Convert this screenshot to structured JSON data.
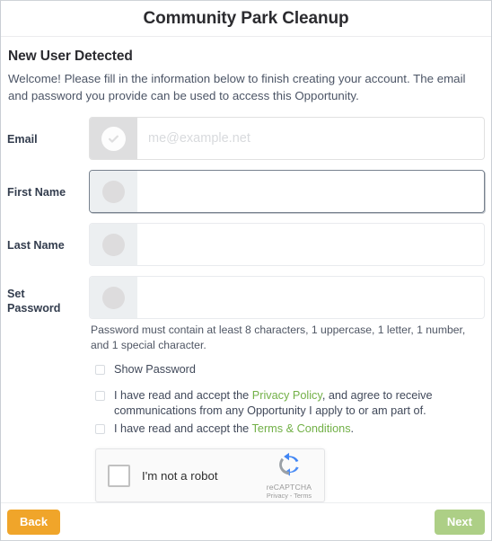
{
  "header": {
    "title": "Community Park Cleanup"
  },
  "main": {
    "section_title": "New User Detected",
    "intro": "Welcome! Please fill in the information below to finish creating your account. The email and password you provide can be used to access this Opportunity."
  },
  "fields": [
    {
      "label": "Email",
      "value": "",
      "placeholder": "me@example.net",
      "icon": "check-circle-icon",
      "state": "verified"
    },
    {
      "label": "First Name",
      "value": "",
      "placeholder": "",
      "icon": "user-circle-icon",
      "state": "focused"
    },
    {
      "label": "Last Name",
      "value": "",
      "placeholder": "",
      "icon": "user-circle-icon",
      "state": "default"
    },
    {
      "label": "Set Password",
      "label_line1": "Set",
      "label_line2": "Password",
      "value": "",
      "placeholder": "",
      "icon": "lock-circle-icon",
      "state": "default",
      "hint": "Password must contain at least 8 characters, 1 uppercase, 1 letter, 1 number, and 1 special character."
    }
  ],
  "checkboxes": {
    "show_password": {
      "label": "Show Password",
      "checked": false
    },
    "privacy": {
      "text_before": "I have read and accept the ",
      "link": "Privacy Policy",
      "text_after": ", and agree to receive communications from any Opportunity I apply to or am part of.",
      "checked": false
    },
    "terms": {
      "text_before": "I have read and accept the ",
      "link": "Terms & Conditions",
      "text_after": ".",
      "checked": false
    }
  },
  "recaptcha": {
    "label": "I'm not a robot",
    "brand": "reCAPTCHA",
    "links": "Privacy - Terms",
    "checked": false
  },
  "footer": {
    "back_label": "Back",
    "next_label": "Next"
  },
  "colors": {
    "link_green": "#72b047",
    "back_orange": "#f0a52a",
    "next_green": "#adcf86",
    "label_navy": "#333d4e"
  }
}
